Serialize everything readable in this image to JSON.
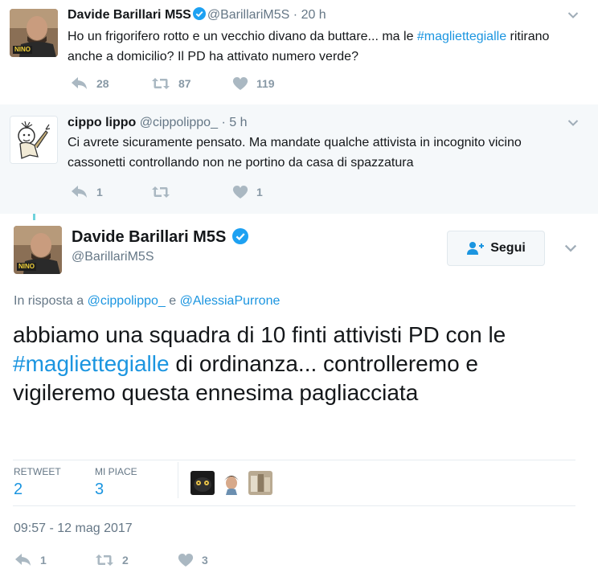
{
  "tweet1": {
    "name": "Davide Barillari M5S",
    "handle": "@BarillariM5S",
    "dot": "·",
    "time": "20 h",
    "text_a": "Ho un frigorifero rotto e un vecchio divano da buttare... ma le ",
    "hashtag": "#magliettegialle",
    "text_b": " ritirano anche a domicilio? Il PD ha attivato numero verde?",
    "replies": "28",
    "retweets": "87",
    "likes": "119",
    "avatar_text": "NINO"
  },
  "tweet2": {
    "name": "cippo lippo",
    "handle": "@cippolippo_",
    "dot": "·",
    "time": "5 h",
    "text": "Ci avrete sicuramente pensato. Ma mandate qualche attivista in incognito vicino cassonetti controllando non ne portino da casa di spazzatura",
    "replies": "1",
    "likes": "1"
  },
  "main": {
    "name": "Davide Barillari M5S",
    "handle": "@BarillariM5S",
    "follow_label": "Segui",
    "reply_prefix": "In risposta a",
    "mention1": "@cippolippo_",
    "reply_and": "e",
    "mention2": "@AlessiaPurrone",
    "text_a": "abbiamo una squadra di 10 finti attivisti PD con le ",
    "hashtag": "#magliettegialle",
    "text_b": " di ordinanza... controlleremo e vigileremo questa ennesima pagliacciata",
    "retweet_label": "RETWEET",
    "retweet_count": "2",
    "like_label": "MI PIACE",
    "like_count": "3",
    "timestamp": "09:57 - 12 mag 2017",
    "footer_replies": "1",
    "footer_retweets": "2",
    "footer_likes": "3"
  },
  "colors": {
    "link": "#1b95e0",
    "muted": "#657786",
    "action_icon": "#8899a6",
    "thread_line": "#6fd3dc",
    "reply_bg": "#f5f8fa"
  }
}
